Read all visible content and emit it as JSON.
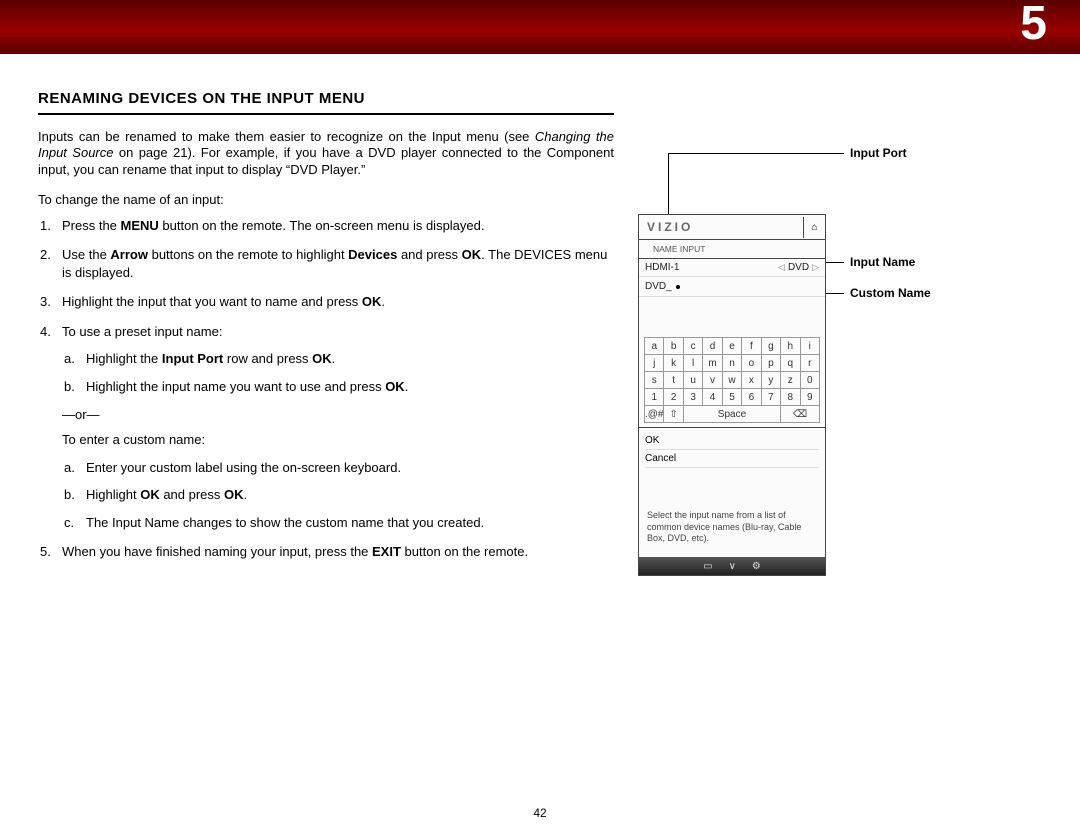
{
  "chapter_number": "5",
  "section_title": "RENAMING DEVICES ON THE INPUT MENU",
  "intro_prefix": "Inputs can be renamed to make them easier to recognize on the Input menu (see ",
  "intro_italic": "Changing the Input Source",
  "intro_suffix": " on page 21). For example, if you have a DVD player connected to the Component input, you can rename that input to display “DVD Player.”",
  "lead": "To change the name of an input:",
  "steps": {
    "s1a": "Press the ",
    "s1b": "MENU",
    "s1c": " button on the remote. The on-screen menu is displayed.",
    "s2a": "Use the ",
    "s2b": "Arrow",
    "s2c": " buttons on the remote to highlight ",
    "s2d": "Devices",
    "s2e": " and press ",
    "s2f": "OK",
    "s2g": ". The DEVICES menu is displayed.",
    "s3a": "Highlight the input that you want to name and press ",
    "s3b": "OK",
    "s3c": ".",
    "s4": "To use a preset input name:",
    "s4a_a": "Highlight the ",
    "s4a_b": "Input Port",
    "s4a_c": " row and press ",
    "s4a_d": "OK",
    "s4a_e": ".",
    "s4b_a": "Highlight the input name you want to use and press ",
    "s4b_b": "OK",
    "s4b_c": ".",
    "or": "—or—",
    "s4custom_lead": "To enter a custom name:",
    "s4c_a": "Enter your custom label using the on-screen keyboard.",
    "s4d_a": "Highlight ",
    "s4d_b": "OK",
    "s4d_c": " and press ",
    "s4d_d": "OK",
    "s4d_e": ".",
    "s4e_a": "The Input Name changes to show the custom name that you created.",
    "s5a": "When you have finished naming your input, press the ",
    "s5b": "EXIT",
    "s5c": " button on the remote."
  },
  "callouts": {
    "input_port": "Input Port",
    "input_name": "Input Name",
    "custom_name": "Custom Name"
  },
  "osd": {
    "brand": "VIZIO",
    "breadcrumb": "NAME INPUT",
    "port_label": "HDMI-1",
    "port_value": "DVD",
    "custom_value": "DVD_",
    "keys_r1": [
      "a",
      "b",
      "c",
      "d",
      "e",
      "f",
      "g",
      "h",
      "i"
    ],
    "keys_r2": [
      "j",
      "k",
      "l",
      "m",
      "n",
      "o",
      "p",
      "q",
      "r"
    ],
    "keys_r3": [
      "s",
      "t",
      "u",
      "v",
      "w",
      "x",
      "y",
      "z",
      "0"
    ],
    "keys_r4": [
      "1",
      "2",
      "3",
      "4",
      "5",
      "6",
      "7",
      "8",
      "9"
    ],
    "keys_r5_sym": ".@#",
    "keys_r5_shift": "⇧",
    "keys_r5_space": "Space",
    "keys_r5_back": "⌫",
    "ok": "OK",
    "cancel": "Cancel",
    "hint": "Select the input name from a list of common device names (Blu-ray, Cable Box, DVD, etc).",
    "footer_icons": [
      "▭",
      "∨",
      "⚙"
    ]
  },
  "page_number": "42"
}
